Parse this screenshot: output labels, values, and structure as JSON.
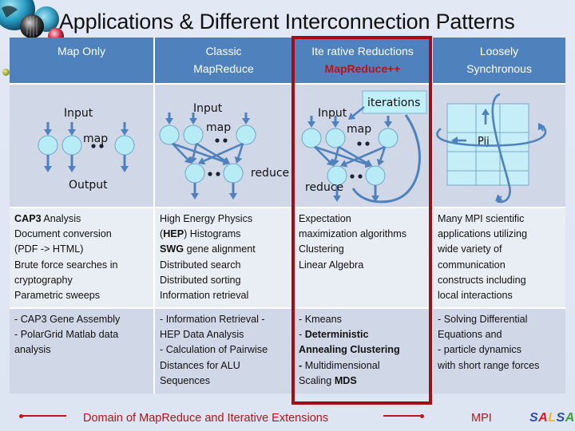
{
  "title": "Applications & Different Interconnection Patterns",
  "columns": [
    {
      "id": "map-only",
      "header": [
        "Map Only"
      ],
      "diagram": {
        "input_label": "Input",
        "map_label": "map",
        "output_label": "Output"
      },
      "examples_1": [
        [
          {
            "t": "CAP3",
            "b": true
          },
          {
            "t": " Analysis"
          }
        ],
        [
          {
            "t": "Document conversion"
          }
        ],
        [
          {
            "t": "(PDF -> HTML)"
          }
        ],
        [
          {
            "t": "Brute force searches in"
          }
        ],
        [
          {
            "t": "cryptography"
          }
        ],
        [
          {
            "t": "Parametric sweeps"
          }
        ]
      ],
      "examples_2": [
        [
          {
            "t": "- CAP3 Gene Assembly"
          }
        ],
        [
          {
            "t": "- PolarGrid Matlab data"
          }
        ],
        [
          {
            "t": "analysis"
          }
        ]
      ]
    },
    {
      "id": "classic-mapreduce",
      "header": [
        "Classic",
        "MapReduce"
      ],
      "diagram": {
        "input_label": "Input",
        "map_label": "map",
        "reduce_label": "reduce"
      },
      "examples_1": [
        [
          {
            "t": "High Energy Physics"
          }
        ],
        [
          {
            "t": "("
          },
          {
            "t": "HEP",
            "b": true
          },
          {
            "t": ") Histograms"
          }
        ],
        [
          {
            "t": "SWG",
            "b": true
          },
          {
            "t": " gene alignment"
          }
        ],
        [
          {
            "t": "Distributed search"
          }
        ],
        [
          {
            "t": "Distributed sorting"
          }
        ],
        [
          {
            "t": "Information retrieval"
          }
        ]
      ],
      "examples_2": [
        [
          {
            "t": "- Information Retrieval -"
          }
        ],
        [
          {
            "t": "HEP Data Analysis"
          }
        ],
        [
          {
            "t": "- Calculation of Pairwise"
          }
        ],
        [
          {
            "t": "Distances for ALU"
          }
        ],
        [
          {
            "t": "Sequences"
          }
        ]
      ]
    },
    {
      "id": "iterative-reductions",
      "header": [
        "Ite rative Reductions",
        "MapReduce++"
      ],
      "header_highlight_line": 1,
      "diagram": {
        "input_label": "Input",
        "map_label": "map",
        "reduce_label": "reduce",
        "iterations_label": "iterations"
      },
      "examples_1": [
        [
          {
            "t": "Expectation"
          }
        ],
        [
          {
            "t": "maximization algorithms"
          }
        ],
        [
          {
            "t": "Clustering"
          }
        ],
        [
          {
            "t": "Linear Algebra"
          }
        ]
      ],
      "examples_2": [
        [
          {
            "t": "- Kmeans"
          }
        ],
        [
          {
            "t": "- "
          },
          {
            "t": "Deterministic",
            "b": true
          }
        ],
        [
          {
            "t": "Annealing  Clustering",
            "b": true
          }
        ],
        [
          {
            "t": "-",
            "b": true
          },
          {
            "t": " Multidimensional"
          }
        ],
        [
          {
            "t": "Scaling "
          },
          {
            "t": "MDS",
            "b": true
          }
        ]
      ]
    },
    {
      "id": "loosely-synchronous",
      "header": [
        "Loosely",
        "Synchronous"
      ],
      "diagram": {
        "cell_label": "Pij"
      },
      "examples_1": [
        [
          {
            "t": "Many MPI scientific"
          }
        ],
        [
          {
            "t": "applications utilizing"
          }
        ],
        [
          {
            "t": "wide variety of"
          }
        ],
        [
          {
            "t": "communication"
          }
        ],
        [
          {
            "t": "constructs including"
          }
        ],
        [
          {
            "t": "local interactions"
          }
        ]
      ],
      "examples_2": [
        [
          {
            "t": "- Solving Differential"
          }
        ],
        [
          {
            "t": "Equations and"
          }
        ],
        [
          {
            "t": "- particle dynamics"
          }
        ],
        [
          {
            "t": "with short range forces"
          }
        ]
      ]
    }
  ],
  "footer": {
    "domain_label": "Domain of MapReduce and Iterative Extensions",
    "mpi_label": "MPI",
    "logo": {
      "letters": [
        "S",
        "A",
        "L",
        "S",
        "A"
      ],
      "colors": [
        "#2a4fa8",
        "#d6201f",
        "#f1b81c",
        "#2a4fa8",
        "#3aa13a"
      ]
    }
  },
  "colors": {
    "header_bg": "#4f81bd",
    "highlight_red": "#a50d12",
    "legend_red": "#c0161c",
    "arrow_blue": "#4f81bd",
    "node_fill": "#b7ecf7"
  }
}
